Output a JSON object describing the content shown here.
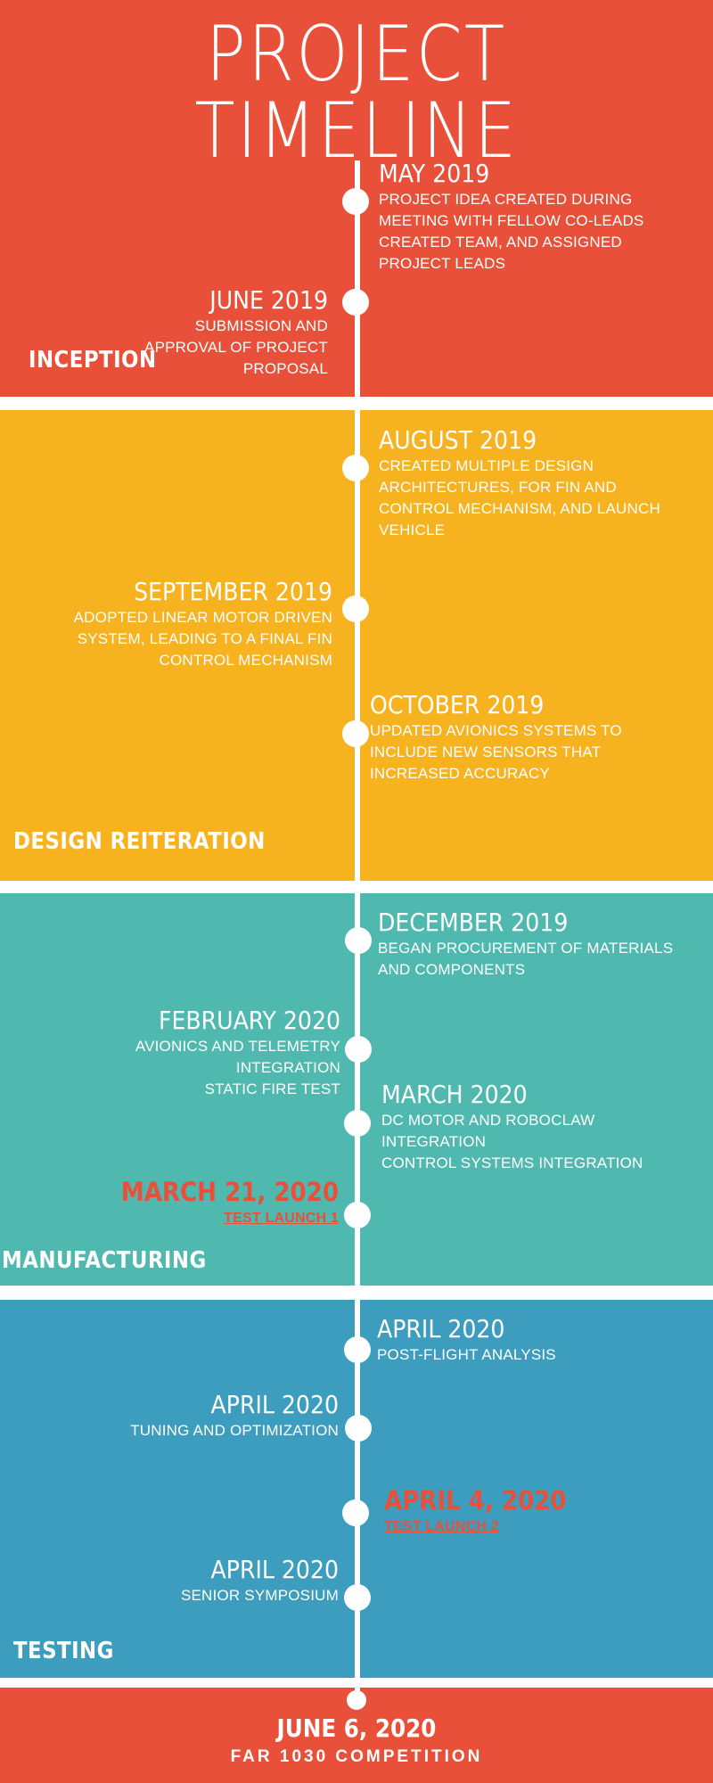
{
  "title": "PROJECT TIMELINE",
  "colors": {
    "inception": "#e8503a",
    "design": "#f6b21f",
    "manufacturing": "#4fb9af",
    "testing": "#3d9dbe",
    "highlight": "#e8503a",
    "line": "#ffffff"
  },
  "phases": {
    "inception": "INCEPTION",
    "design": "DESIGN REITERATION",
    "manufacturing": "MANUFACTURING",
    "testing": "TESTING"
  },
  "events": {
    "may2019": {
      "date": "MAY 2019",
      "lines": [
        "PROJECT IDEA CREATED DURING",
        "MEETING WITH FELLOW CO-LEADS",
        "CREATED TEAM, AND ASSIGNED",
        "PROJECT LEADS"
      ]
    },
    "jun2019": {
      "date": "JUNE 2019",
      "lines": [
        "SUBMISSION AND",
        "APPROVAL OF PROJECT",
        "PROPOSAL"
      ]
    },
    "aug2019": {
      "date": "AUGUST 2019",
      "lines": [
        "CREATED MULTIPLE DESIGN",
        "ARCHITECTURES, FOR FIN AND",
        "CONTROL MECHANISM, AND LAUNCH",
        "VEHICLE"
      ]
    },
    "sep2019": {
      "date": "SEPTEMBER 2019",
      "lines": [
        "ADOPTED LINEAR MOTOR DRIVEN",
        "SYSTEM, LEADING TO A FINAL FIN",
        "CONTROL MECHANISM"
      ]
    },
    "oct2019": {
      "date": "OCTOBER 2019",
      "lines": [
        "UPDATED AVIONICS SYSTEMS TO",
        "INCLUDE NEW SENSORS THAT",
        "INCREASED ACCURACY"
      ]
    },
    "dec2019": {
      "date": "DECEMBER 2019",
      "lines": [
        "BEGAN PROCUREMENT OF MATERIALS",
        "AND COMPONENTS"
      ]
    },
    "feb2020": {
      "date": "FEBRUARY 2020",
      "lines": [
        "AVIONICS AND TELEMETRY",
        "INTEGRATION",
        "STATIC FIRE TEST"
      ]
    },
    "mar2020": {
      "date": "MARCH 2020",
      "lines": [
        "DC MOTOR AND ROBOCLAW",
        "INTEGRATION",
        "CONTROL SYSTEMS INTEGRATION"
      ]
    },
    "mar21": {
      "date": "MARCH 21, 2020",
      "lines": [
        "TEST LAUNCH 1"
      ]
    },
    "apr_a": {
      "date": "APRIL 2020",
      "lines": [
        "POST-FLIGHT ANALYSIS"
      ]
    },
    "apr_b": {
      "date": "APRIL 2020",
      "lines": [
        "TUNING AND OPTIMIZATION"
      ]
    },
    "apr4": {
      "date": "APRIL 4, 2020",
      "lines": [
        "TEST LAUNCH 2"
      ]
    },
    "apr_c": {
      "date": "APRIL 2020",
      "lines": [
        "SENIOR SYMPOSIUM"
      ]
    }
  },
  "final": {
    "date": "JUNE 6, 2020",
    "label": "FAR 1030 COMPETITION"
  }
}
